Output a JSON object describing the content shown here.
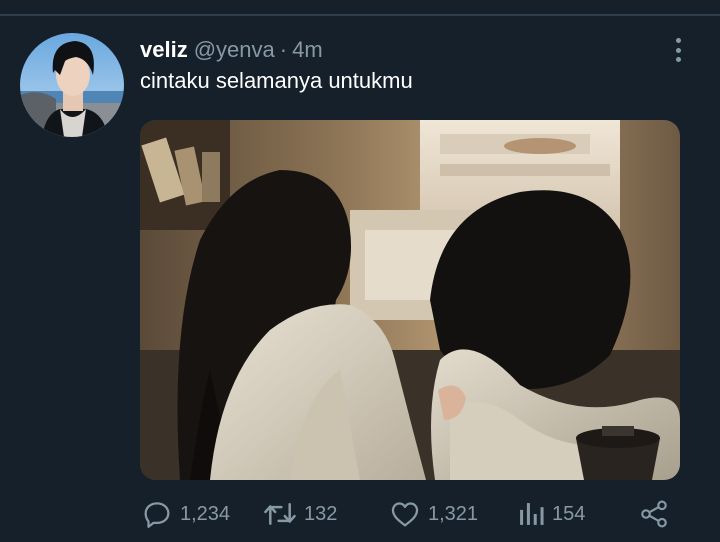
{
  "tweet": {
    "display_name": "veliz",
    "handle": "@yenva",
    "separator": "·",
    "time": "4m",
    "text": "cintaku selamanya untukmu",
    "avatar_icon": "profile-photo",
    "more_icon": "more-options-icon"
  },
  "actions": {
    "reply": {
      "icon": "reply-icon",
      "count": "1,234"
    },
    "retweet": {
      "icon": "retweet-icon",
      "count": "132"
    },
    "like": {
      "icon": "heart-icon",
      "count": "1,321"
    },
    "views": {
      "icon": "analytics-icon",
      "count": "154"
    },
    "share": {
      "icon": "share-icon"
    }
  },
  "colors": {
    "background": "#15202b",
    "text_primary": "#ffffff",
    "text_secondary": "#8899a6",
    "divider": "#2f3e4d"
  }
}
